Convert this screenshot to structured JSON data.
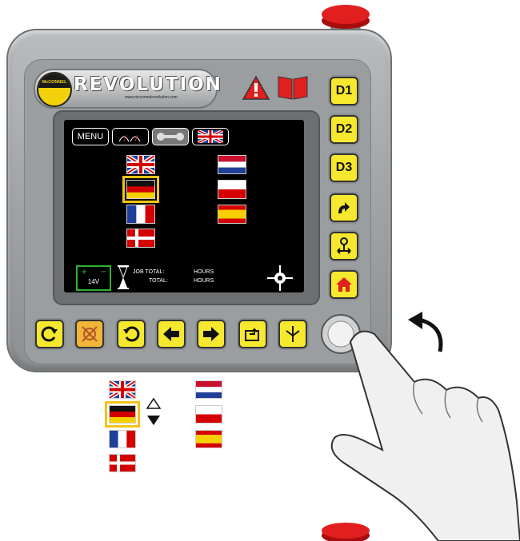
{
  "brand": {
    "logo_text": "McCONNEL",
    "title": "REVOLUTION",
    "url": "www.mcconnelrevolution.com"
  },
  "tabs": {
    "menu_label": "MENU"
  },
  "side_keys": {
    "d1": "D1",
    "d2": "D2",
    "d3": "D3"
  },
  "languages": {
    "left": [
      "english-flag",
      "german-flag",
      "french-flag",
      "danish-flag"
    ],
    "right": [
      "dutch-flag",
      "polish-flag",
      "spanish-flag"
    ],
    "selected": "german-flag"
  },
  "status": {
    "voltage": "14V",
    "job_total_label": "JOB TOTAL:",
    "total_label": "TOTAL:",
    "job_total_unit": "HOURS",
    "total_unit": "HOURS"
  },
  "colors": {
    "key_yellow": "#f6e82e",
    "select_outline": "#f3c316",
    "battery_green": "#2db32d",
    "warning_red": "#e11f1f"
  }
}
